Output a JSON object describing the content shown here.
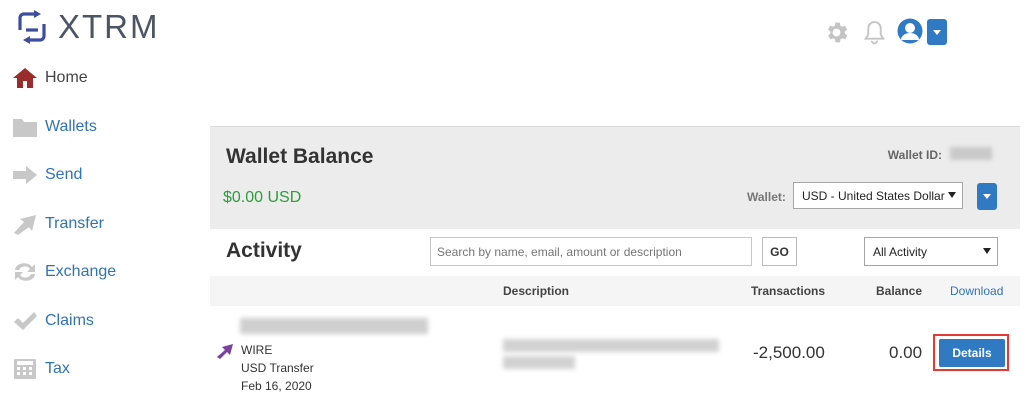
{
  "brand": {
    "name": "XTRM",
    "accent": "#2f7ac3",
    "logo_color": "#3d4d9c"
  },
  "header": {
    "settings_icon": "gear-icon",
    "notifications_icon": "bell-icon",
    "user_icon": "user-avatar-icon"
  },
  "sidebar": {
    "items": [
      {
        "label": "Home",
        "icon": "home-icon",
        "active": true
      },
      {
        "label": "Wallets",
        "icon": "folder-icon"
      },
      {
        "label": "Send",
        "icon": "arrow-right-icon"
      },
      {
        "label": "Transfer",
        "icon": "transfer-arrow-icon"
      },
      {
        "label": "Exchange",
        "icon": "exchange-icon"
      },
      {
        "label": "Claims",
        "icon": "checkmark-icon"
      },
      {
        "label": "Tax",
        "icon": "calculator-icon"
      }
    ]
  },
  "wallet": {
    "title": "Wallet Balance",
    "id_label": "Wallet ID:",
    "balance": "$0.00 USD",
    "balance_color": "#2e9c3a",
    "select_label": "Wallet:",
    "selected": "USD - United States Dollar"
  },
  "activity": {
    "title": "Activity",
    "search_placeholder": "Search by name, email, amount or description",
    "go_label": "GO",
    "filter_selected": "All Activity",
    "columns": {
      "description": "Description",
      "transactions": "Transactions",
      "balance": "Balance",
      "download": "Download"
    },
    "rows": [
      {
        "type": "WIRE",
        "subtype": "USD Transfer",
        "date": "Feb 16, 2020",
        "transaction": "-2,500.00",
        "balance": "0.00",
        "action": "Details"
      }
    ]
  }
}
